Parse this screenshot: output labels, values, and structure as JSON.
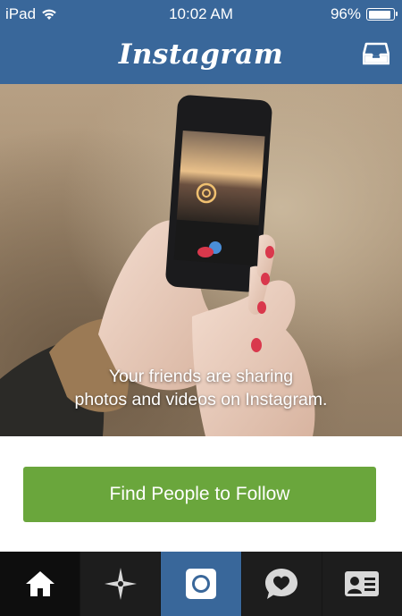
{
  "status_bar": {
    "device": "iPad",
    "time": "10:02 AM",
    "battery_text": "96%",
    "battery_level": 0.96
  },
  "nav": {
    "title": "Instagram",
    "inbox_icon": "inbox-tray-icon"
  },
  "hero": {
    "caption_line1": "Your friends are sharing",
    "caption_line2": "photos and videos on Instagram."
  },
  "cta": {
    "label": "Find People to Follow"
  },
  "tab_bar": {
    "tabs": [
      {
        "id": "home",
        "icon": "home-icon"
      },
      {
        "id": "explore",
        "icon": "explore-star-icon"
      },
      {
        "id": "camera",
        "icon": "camera-icon",
        "active": true
      },
      {
        "id": "activity",
        "icon": "heart-bubble-icon"
      },
      {
        "id": "profile",
        "icon": "profile-card-icon"
      }
    ]
  },
  "colors": {
    "header_blue": "#39679a",
    "cta_green": "#6aa63c",
    "tab_bar": "#1d1d1d"
  }
}
